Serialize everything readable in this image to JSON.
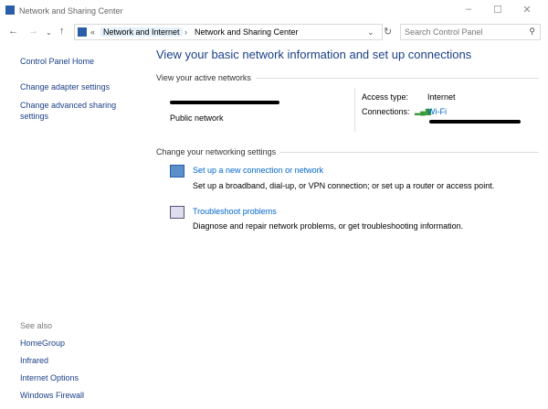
{
  "window": {
    "title": "Network and Sharing Center"
  },
  "address": {
    "crumbs": [
      "«",
      "Network and Internet",
      "Network and Sharing Center"
    ],
    "search_placeholder": "Search Control Panel"
  },
  "sidebar": {
    "home": "Control Panel Home",
    "items": [
      "Change adapter settings",
      "Change advanced sharing settings"
    ],
    "see_also": "See also",
    "see_also_items": [
      "HomeGroup",
      "Infrared",
      "Internet Options",
      "Windows Firewall"
    ]
  },
  "main": {
    "title": "View your basic network information and set up connections",
    "active_header": "View your active networks",
    "network_type": "Public network",
    "access_label": "Access type:",
    "access_value": "Internet",
    "connections_label": "Connections:",
    "connection_value": "Wi-Fi",
    "change_header": "Change your networking settings",
    "actions": [
      {
        "label": "Set up a new connection or network",
        "desc": "Set up a broadband, dial-up, or VPN connection; or set up a router or access point."
      },
      {
        "label": "Troubleshoot problems",
        "desc": "Diagnose and repair network problems, or get troubleshooting information."
      }
    ]
  },
  "colors": {
    "link": "#0066cc",
    "heading": "#1a3f87"
  }
}
